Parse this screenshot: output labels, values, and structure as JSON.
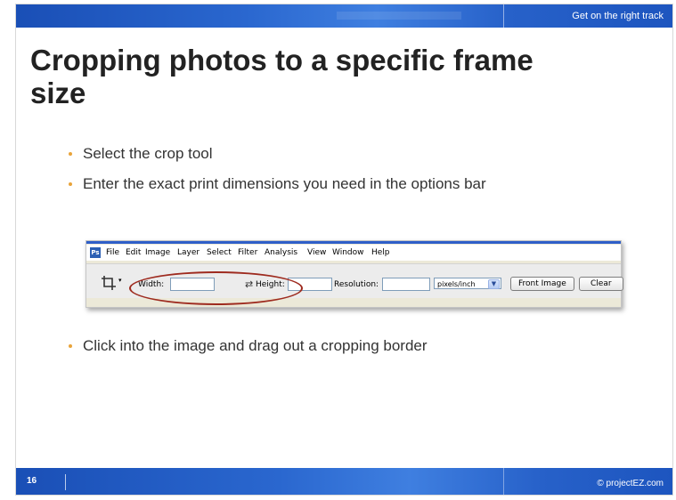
{
  "header": {
    "tagline": "Get on the right track"
  },
  "slide": {
    "title": "Cropping photos to a specific frame size",
    "bullets": [
      "Select the crop tool",
      "Enter the exact print dimensions you need in the options bar",
      "Click into the image and drag out a cropping border"
    ]
  },
  "screenshot": {
    "app_logo": "Ps",
    "menu": [
      "File",
      "Edit",
      "Image",
      "Layer",
      "Select",
      "Filter",
      "Analysis",
      "View",
      "Window",
      "Help"
    ],
    "options": {
      "width_label": "Width:",
      "height_label": "Height:",
      "resolution_label": "Resolution:",
      "units_value": "pixels/inch",
      "front_image_button": "Front Image",
      "clear_button": "Clear"
    },
    "highlight_color": "#9e2b1f"
  },
  "footer": {
    "page_number": "16",
    "copyright": "© projectEZ.com"
  },
  "colors": {
    "bar_blue": "#2a67cf",
    "bullet_marker": "#e8a43a"
  }
}
